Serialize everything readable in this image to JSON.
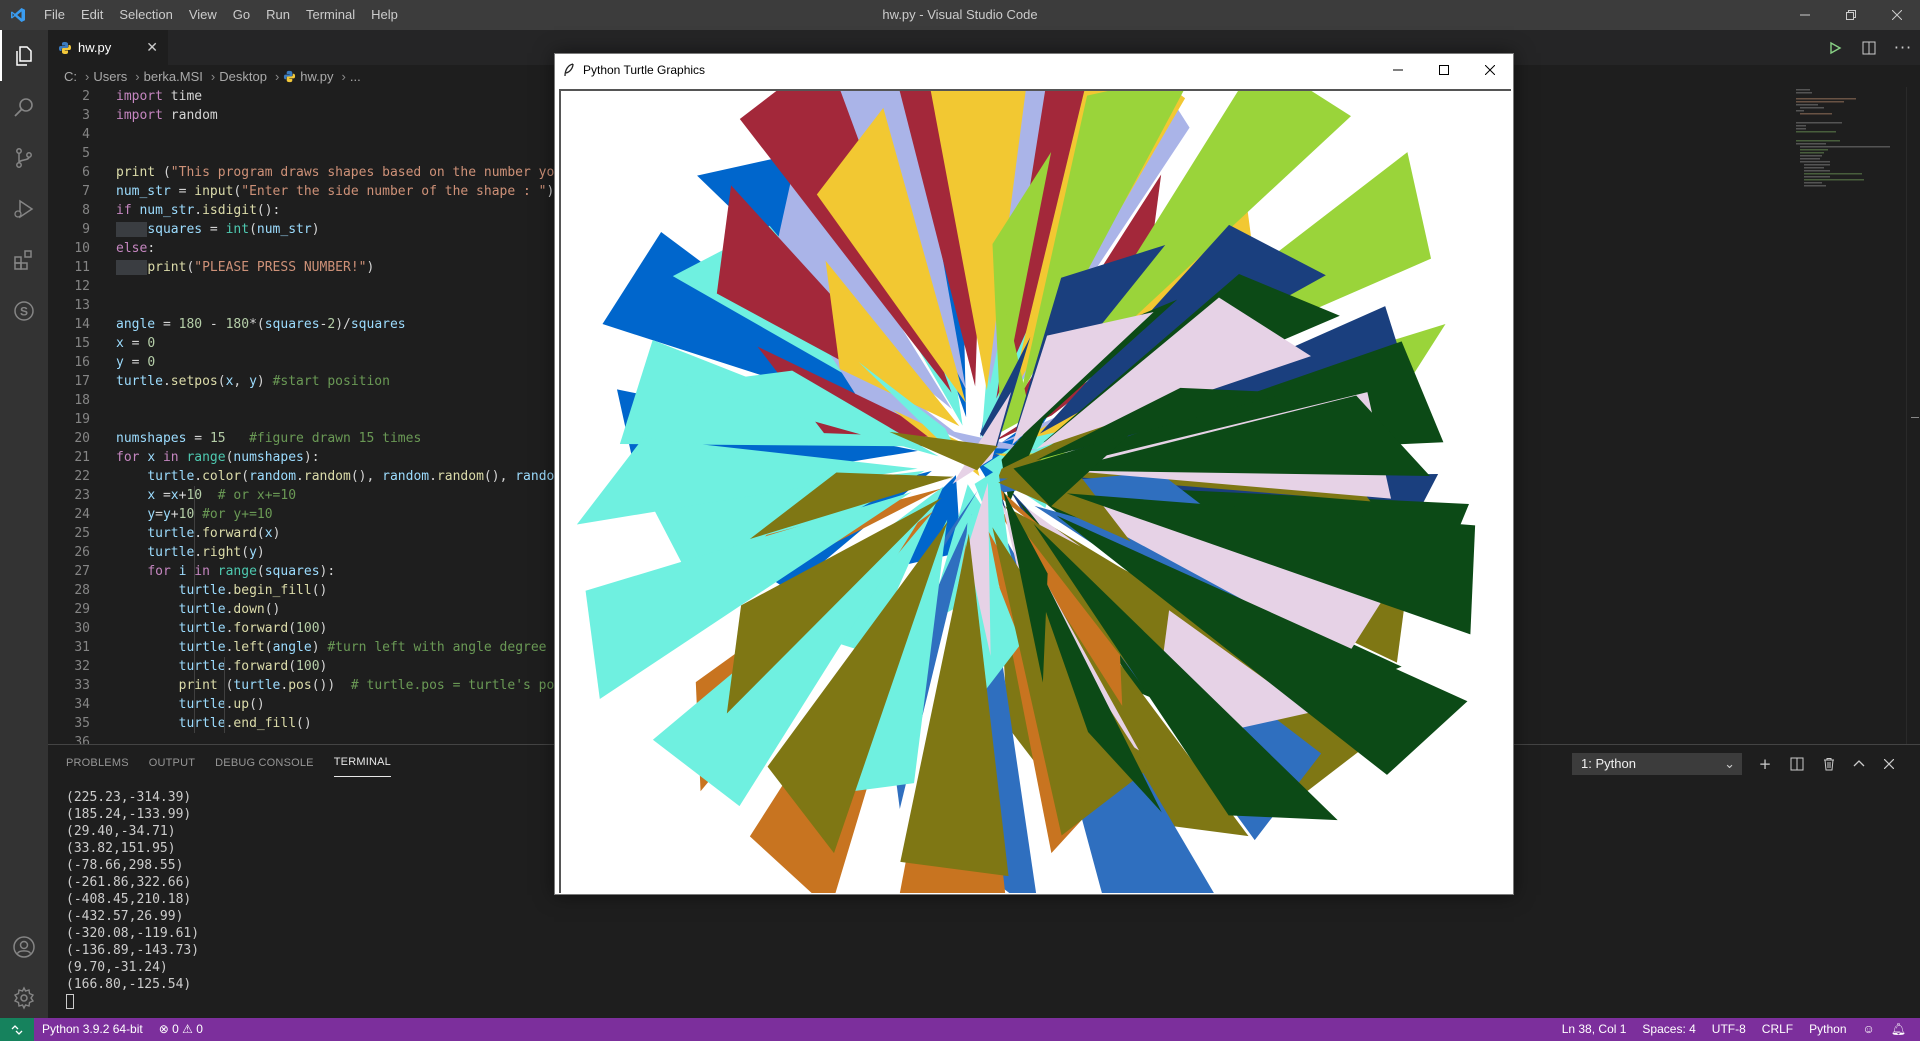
{
  "titlebar": {
    "menu": [
      "File",
      "Edit",
      "Selection",
      "View",
      "Go",
      "Run",
      "Terminal",
      "Help"
    ],
    "window_title": "hw.py - Visual Studio Code"
  },
  "tabs": {
    "active": {
      "label": "hw.py"
    }
  },
  "breadcrumb": {
    "parts": [
      "C:",
      "Users",
      "berka.MSI",
      "Desktop",
      "hw.py",
      "..."
    ]
  },
  "editor": {
    "line_numbers": [
      "2",
      "3",
      "4",
      "5",
      "6",
      "7",
      "8",
      "9",
      "10",
      "11",
      "12",
      "13",
      "14",
      "15",
      "16",
      "17",
      "18",
      "19",
      "20",
      "21",
      "22",
      "23",
      "24",
      "25",
      "26",
      "27",
      "28",
      "29",
      "30",
      "31",
      "32",
      "33",
      "34",
      "35",
      "36"
    ]
  },
  "panel": {
    "tabs": [
      "PROBLEMS",
      "OUTPUT",
      "DEBUG CONSOLE",
      "TERMINAL"
    ],
    "active_tab": "TERMINAL",
    "terminal_select": "1: Python",
    "terminal_lines": [
      "(225.23,-314.39)",
      "(185.24,-133.99)",
      "(29.40,-34.71)",
      "(33.82,151.95)",
      "(-78.66,298.55)",
      "(-261.86,322.66)",
      "(-408.45,210.18)",
      "(-432.57,26.99)",
      "(-320.08,-119.61)",
      "(-136.89,-143.73)",
      "(9.70,-31.24)",
      "(166.80,-125.54)"
    ]
  },
  "statusbar": {
    "interpreter": "Python 3.9.2 64-bit",
    "errors": "0",
    "warnings": "0",
    "position": "Ln 38, Col 1",
    "spaces": "Spaces: 4",
    "encoding": "UTF-8",
    "eol": "CRLF",
    "language": "Python",
    "color": "#7c2f9c"
  },
  "turtle_window": {
    "title": "Python Turtle Graphics"
  }
}
